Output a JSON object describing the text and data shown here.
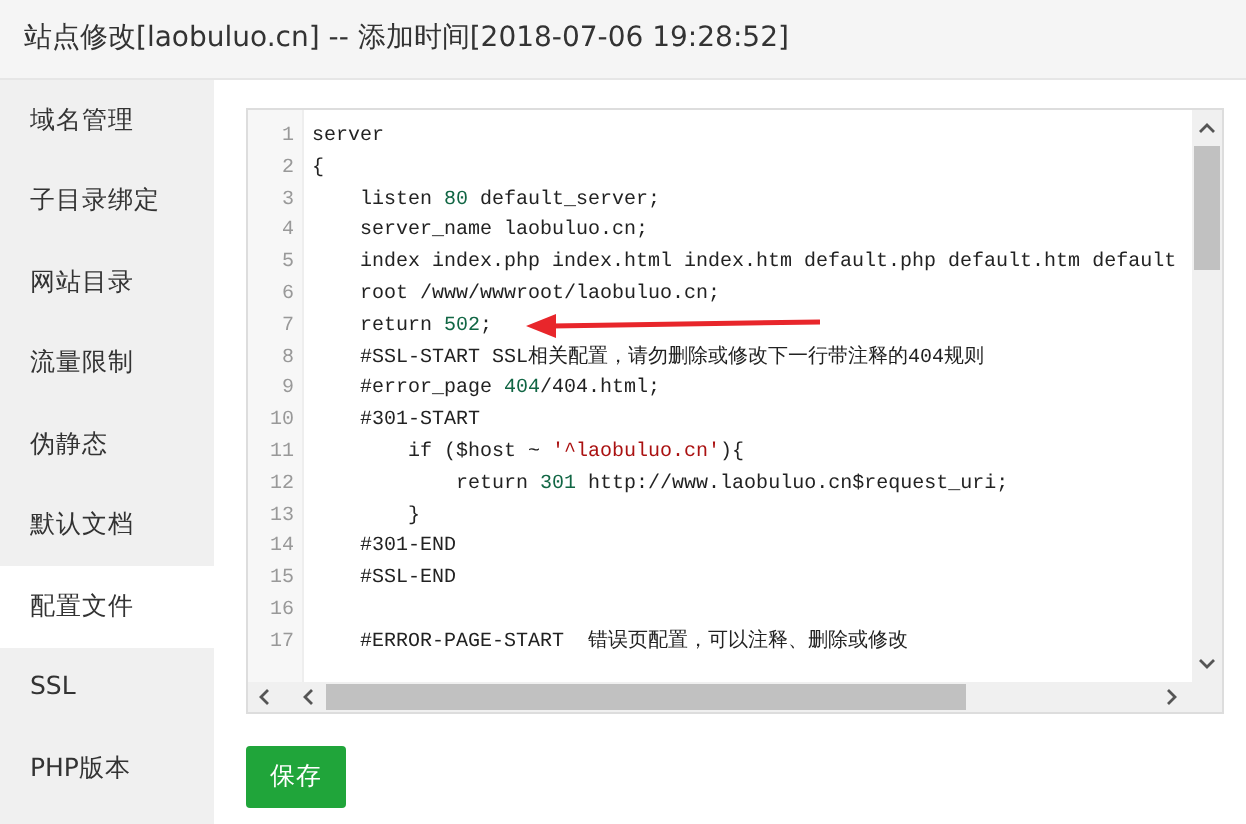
{
  "window": {
    "title": "站点修改[laobuluo.cn] -- 添加时间[2018-07-06 19:28:52]"
  },
  "sidebar": {
    "items": [
      {
        "label": "域名管理",
        "selected": false
      },
      {
        "label": "子目录绑定",
        "selected": false
      },
      {
        "label": "网站目录",
        "selected": false
      },
      {
        "label": "流量限制",
        "selected": false
      },
      {
        "label": "伪静态",
        "selected": false
      },
      {
        "label": "默认文档",
        "selected": false
      },
      {
        "label": "配置文件",
        "selected": true
      },
      {
        "label": "SSL",
        "selected": false
      },
      {
        "label": "PHP版本",
        "selected": false
      }
    ]
  },
  "editor": {
    "lines": [
      {
        "number": "1",
        "tokens": [
          {
            "kind": "plain",
            "text": "server"
          }
        ]
      },
      {
        "number": "2",
        "tokens": [
          {
            "kind": "plain",
            "text": "{"
          }
        ]
      },
      {
        "number": "3",
        "tokens": [
          {
            "kind": "plain",
            "text": "    listen "
          },
          {
            "kind": "number",
            "text": "80"
          },
          {
            "kind": "plain",
            "text": " default_server;"
          }
        ]
      },
      {
        "number": "4",
        "tokens": [
          {
            "kind": "plain",
            "text": "    server_name laobuluo.cn;"
          }
        ]
      },
      {
        "number": "5",
        "tokens": [
          {
            "kind": "plain",
            "text": "    index index.php index.html index.htm default.php default.htm default"
          }
        ]
      },
      {
        "number": "6",
        "tokens": [
          {
            "kind": "plain",
            "text": "    root /www/wwwroot/laobuluo.cn;"
          }
        ]
      },
      {
        "number": "7",
        "tokens": [
          {
            "kind": "plain",
            "text": "    return "
          },
          {
            "kind": "number",
            "text": "502"
          },
          {
            "kind": "plain",
            "text": ";"
          }
        ]
      },
      {
        "number": "8",
        "tokens": [
          {
            "kind": "plain",
            "text": "    #SSL-START SSL相关配置，请勿删除或修改下一行带注释的404规则"
          }
        ]
      },
      {
        "number": "9",
        "tokens": [
          {
            "kind": "plain",
            "text": "    #error_page "
          },
          {
            "kind": "number",
            "text": "404"
          },
          {
            "kind": "plain",
            "text": "/404.html;"
          }
        ]
      },
      {
        "number": "10",
        "tokens": [
          {
            "kind": "plain",
            "text": "    #301-START"
          }
        ]
      },
      {
        "number": "11",
        "tokens": [
          {
            "kind": "plain",
            "text": "        if ($host ~ "
          },
          {
            "kind": "string",
            "text": "'^laobuluo.cn'"
          },
          {
            "kind": "plain",
            "text": "){"
          }
        ]
      },
      {
        "number": "12",
        "tokens": [
          {
            "kind": "plain",
            "text": "            return "
          },
          {
            "kind": "number",
            "text": "301"
          },
          {
            "kind": "plain",
            "text": " http://www.laobuluo.cn$request_uri;"
          }
        ]
      },
      {
        "number": "13",
        "tokens": [
          {
            "kind": "plain",
            "text": "        }"
          }
        ]
      },
      {
        "number": "14",
        "tokens": [
          {
            "kind": "plain",
            "text": "    #301-END"
          }
        ]
      },
      {
        "number": "15",
        "tokens": [
          {
            "kind": "plain",
            "text": "    #SSL-END"
          }
        ]
      },
      {
        "number": "16"
      },
      {
        "number": "17",
        "tokens": [
          {
            "kind": "plain",
            "text": "    #ERROR-PAGE-START  错误页配置，可以注释、删除或修改"
          }
        ]
      }
    ]
  },
  "save_button": {
    "label": "保存"
  }
}
